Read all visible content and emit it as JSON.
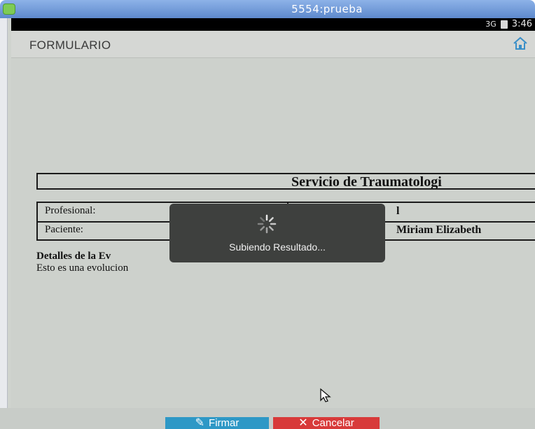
{
  "window": {
    "title": "5554:prueba"
  },
  "status_bar": {
    "network": "3G",
    "time": "3:46"
  },
  "action_bar": {
    "title": "FORMULARIO",
    "home_icon": "home-icon"
  },
  "report": {
    "header": "Servicio de Traumatologi",
    "rows": [
      {
        "label": "Profesional:",
        "value": "l"
      },
      {
        "label": "Paciente:",
        "value": "Miriam Elizabeth"
      }
    ],
    "details_heading": "Detalles de la Ev",
    "details_text": "Esto es una evolucion"
  },
  "progress_dialog": {
    "message": "Subiendo Resultado..."
  },
  "buttons": {
    "sign_label": "Firmar",
    "cancel_label": "Cancelar"
  },
  "colors": {
    "sign_button": "#2e98c6",
    "cancel_button": "#d83a3a",
    "toast": "#3e403e"
  }
}
